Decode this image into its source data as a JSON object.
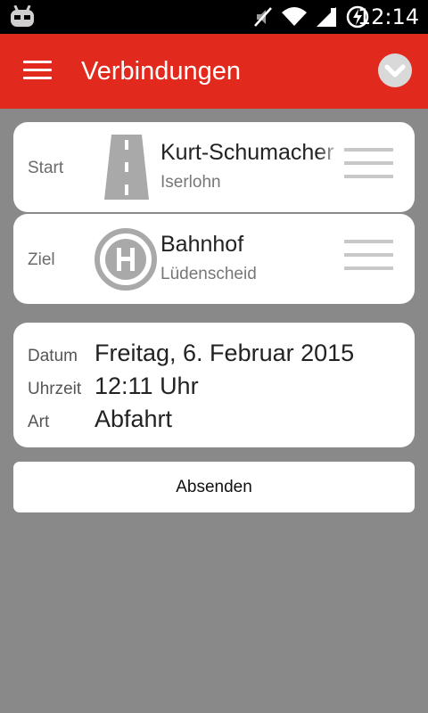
{
  "status_bar": {
    "time": "12:14",
    "icons": [
      "android-robot-icon",
      "mute-icon",
      "wifi-icon",
      "signal-icon",
      "battery-charging-icon"
    ]
  },
  "app_bar": {
    "title": "Verbindungen",
    "background_color": "#e12a1d",
    "menu_icon": "hamburger-menu-icon",
    "dropdown_icon": "chevron-down-circle-icon"
  },
  "start": {
    "label": "Start",
    "icon": "road-icon",
    "name": "Kurt-Schumacher",
    "city": "Iserlohn",
    "handle_icon": "drag-handle-icon"
  },
  "ziel": {
    "label": "Ziel",
    "icon": "bus-stop-h-icon",
    "name": "Bahnhof",
    "city": "Lüdenscheid",
    "handle_icon": "drag-handle-icon"
  },
  "details": {
    "datum_label": "Datum",
    "datum_value": "Freitag, 6. Februar 2015",
    "uhrzeit_label": "Uhrzeit",
    "uhrzeit_value": "12:11 Uhr",
    "art_label": "Art",
    "art_value": "Abfahrt"
  },
  "submit_label": "Absenden"
}
